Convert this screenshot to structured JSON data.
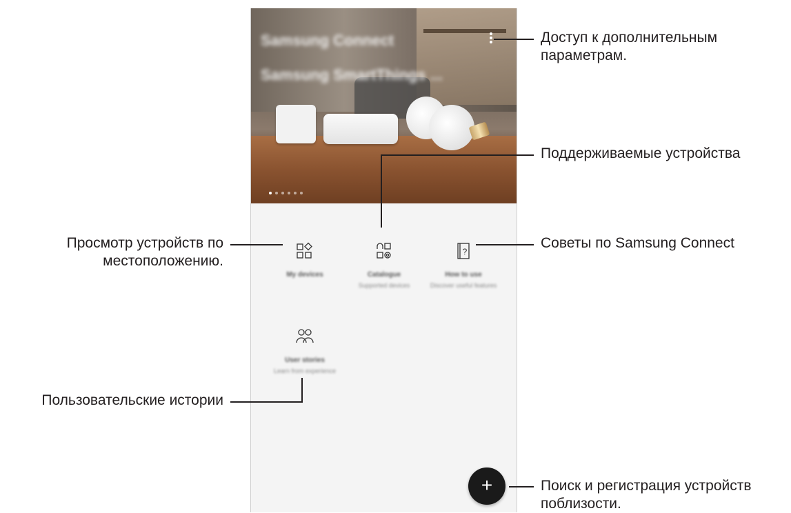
{
  "annotations": {
    "more_options": [
      "Доступ к дополнительным",
      "параметрам."
    ],
    "supported_devices": "Поддерживаемые устройства",
    "view_by_location": [
      "Просмотр устройств по",
      "местоположению."
    ],
    "tips": "Советы по Samsung Connect",
    "user_stories": "Пользовательские истории",
    "search_register": [
      "Поиск и регистрация устройств",
      "поблизости."
    ]
  },
  "hero": {
    "title": "Samsung Connect",
    "subtitle": "Samsung SmartThings ...",
    "page_count": 6,
    "active_page": 1
  },
  "tiles": {
    "my_devices": {
      "title": "My devices",
      "icon": "devices-icon"
    },
    "catalogue": {
      "title": "Catalogue",
      "subtitle": "Supported devices",
      "icon": "catalogue-icon"
    },
    "how_to_use": {
      "title": "How to use",
      "subtitle": "Discover useful features",
      "icon": "help-book-icon"
    },
    "user_stories": {
      "title": "User stories",
      "subtitle": "Learn from experience",
      "icon": "people-icon"
    }
  },
  "fab": {
    "label": "+",
    "icon": "add-icon"
  },
  "colors": {
    "text": "#231f20",
    "fab": "#1a1a1a",
    "screen_bg": "#f4f4f4"
  }
}
